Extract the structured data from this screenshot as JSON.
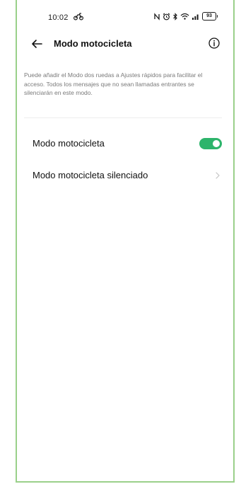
{
  "status_bar": {
    "time": "10:02",
    "left_icon": "motorcycle-icon",
    "right_icons": [
      "nfc-icon",
      "alarm-icon",
      "bluetooth-icon",
      "wifi-icon",
      "signal-icon"
    ],
    "battery": "93"
  },
  "header": {
    "title": "Modo motocicleta",
    "back_icon": "back-arrow-icon",
    "info_icon": "info-icon"
  },
  "description": "Puede añadir el Modo dos ruedas a Ajustes rápidos para facilitar el acceso. Todos los mensajes que no sean llamadas entrantes se silenciarán en este modo.",
  "settings": [
    {
      "label": "Modo motocicleta",
      "control": "toggle",
      "enabled": true
    },
    {
      "label": "Modo motocicleta silenciado",
      "control": "chevron"
    }
  ],
  "colors": {
    "accent": "#2db46b",
    "frame_border": "#9ad08a",
    "description_text": "#7a7a7a"
  }
}
